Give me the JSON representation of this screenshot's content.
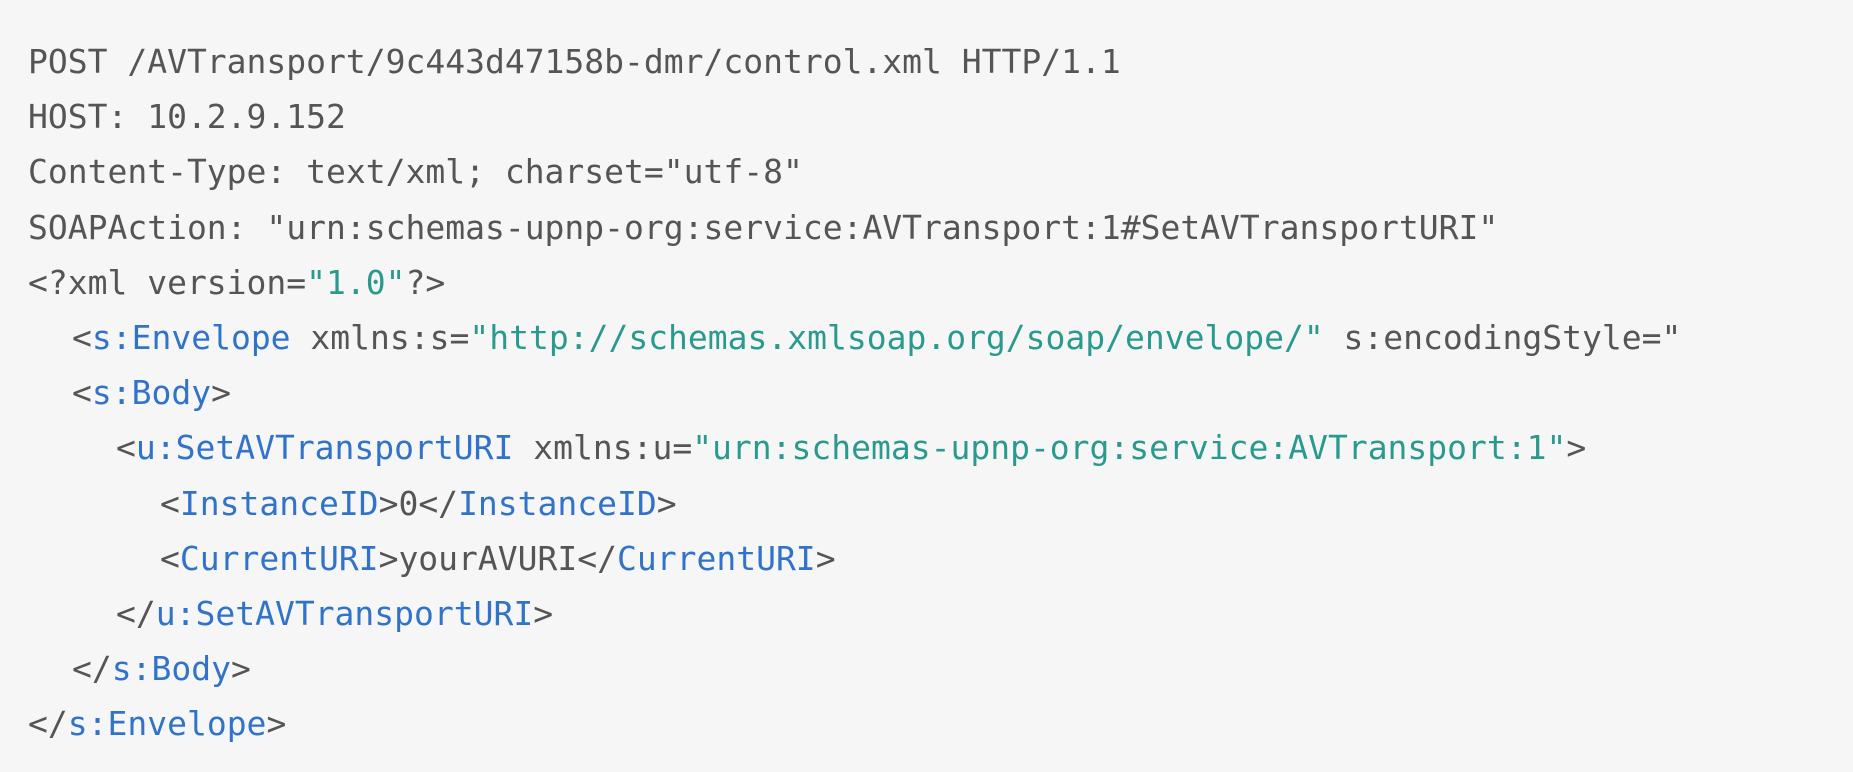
{
  "colors": {
    "background": "#f6f6f6",
    "plain_text": "#555555",
    "tag_name": "#3173c8",
    "attr_value": "#2a9a8e"
  },
  "http": {
    "request_line": "POST /AVTransport/9c443d47158b-dmr/control.xml HTTP/1.1",
    "host": "HOST: 10.2.9.152",
    "content_type": "Content-Type: text/xml; charset=\"utf-8\"",
    "soap_action": "SOAPAction: \"urn:schemas-upnp-org:service:AVTransport:1#SetAVTransportURI\""
  },
  "xml": {
    "decl_open": "<?xml version=",
    "decl_version": "\"1.0\"",
    "decl_close": "?>",
    "envelope": {
      "open_bracket": "<",
      "tag": "s:Envelope",
      "attr1_name": " xmlns:s=",
      "attr1_value": "\"http://schemas.xmlsoap.org/soap/envelope/\"",
      "attr2_name": " s:encodingStyle=\"",
      "close_tag": "s:Envelope"
    },
    "body": {
      "tag": "s:Body"
    },
    "action": {
      "tag": "u:SetAVTransportURI",
      "attr_name": " xmlns:u=",
      "attr_value": "\"urn:schemas-upnp-org:service:AVTransport:1\""
    },
    "instance": {
      "tag": "InstanceID",
      "value": "0"
    },
    "current_uri": {
      "tag": "CurrentURI",
      "value": "yourAVURI"
    }
  },
  "punct": {
    "lt": "<",
    "gt": ">",
    "lt_slash": "</"
  }
}
